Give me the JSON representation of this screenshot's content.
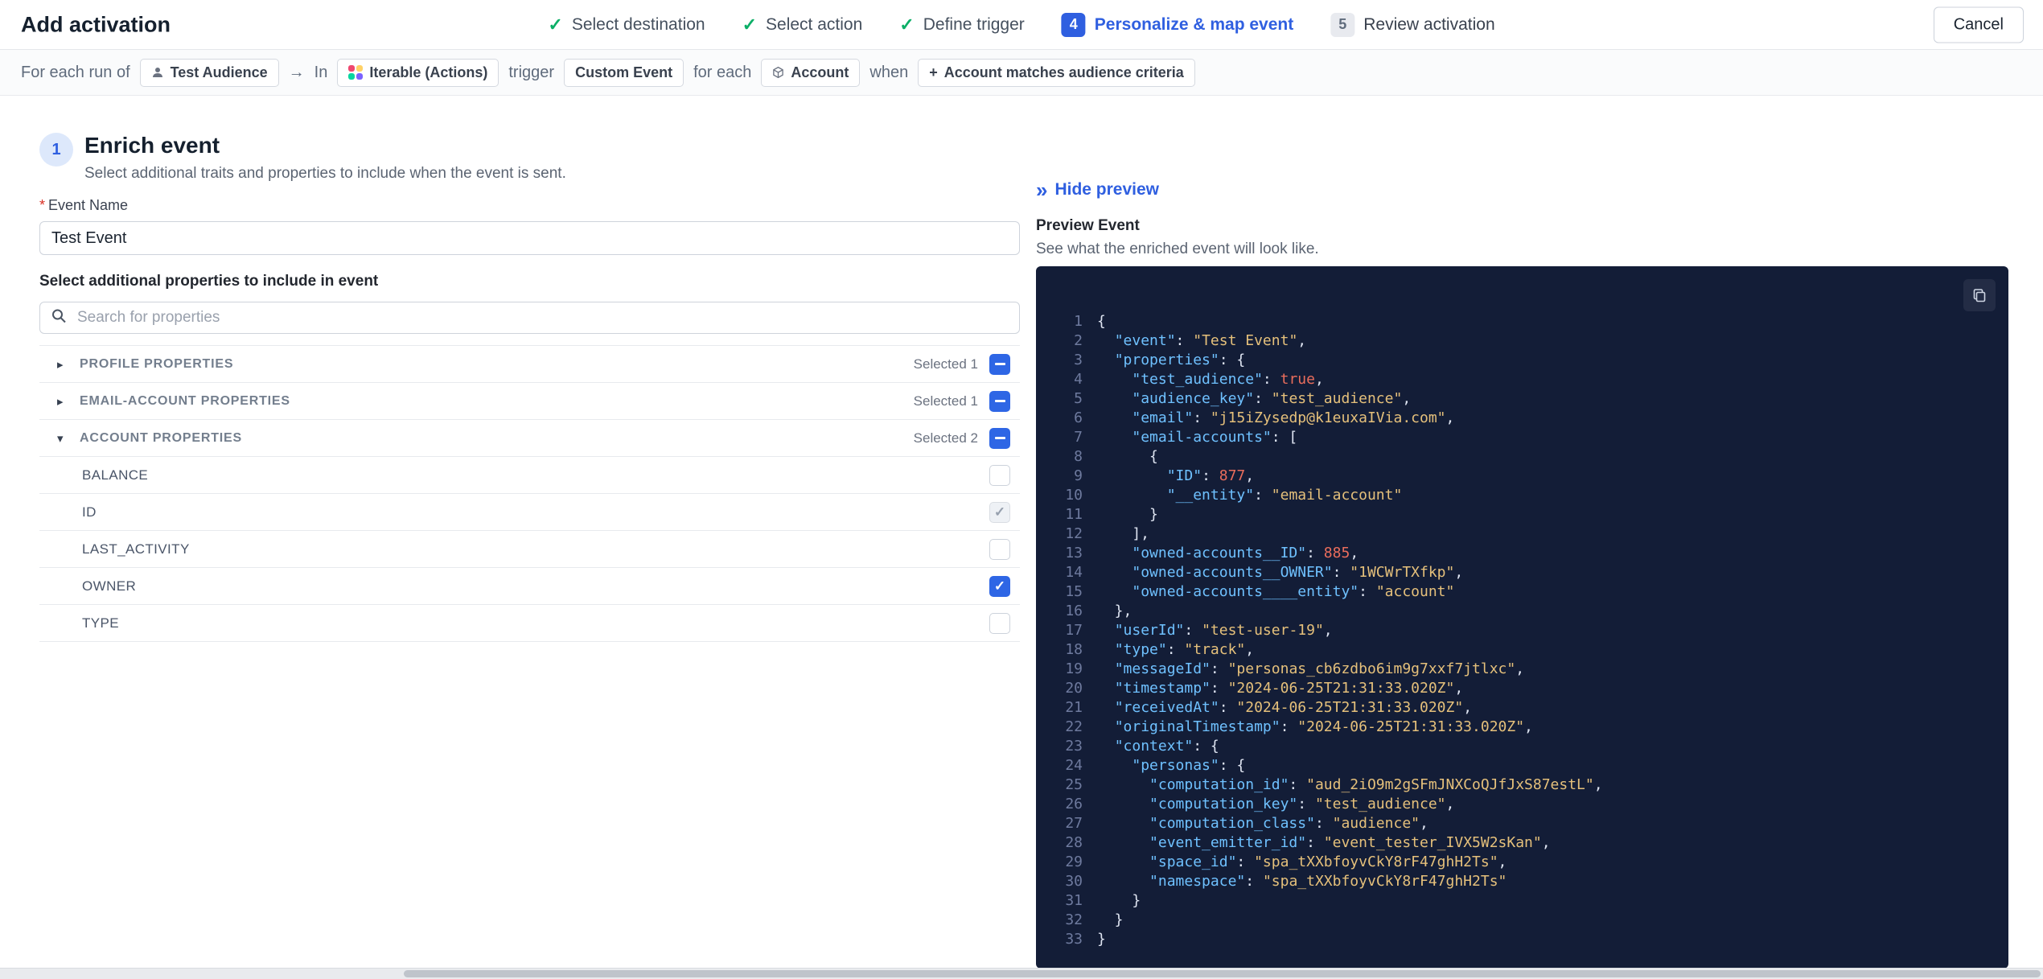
{
  "colors": {
    "accent_blue": "#2f5fe0",
    "checkbox_blue": "#2e66e5",
    "success_green": "#0caf67",
    "code_background": "#131d37",
    "code_key": "#6fc1ff",
    "code_string": "#e5c07b",
    "code_number": "#ea6d5c"
  },
  "icons": {
    "check": "✓",
    "chevron_right": "▸",
    "chevron_down": "▾",
    "arrow": "→",
    "plus": "+",
    "double_chevron": "»"
  },
  "header": {
    "title": "Add activation",
    "cancel_label": "Cancel",
    "steps": [
      {
        "label": "Select destination",
        "state": "complete"
      },
      {
        "label": "Select action",
        "state": "complete"
      },
      {
        "label": "Define trigger",
        "state": "complete"
      },
      {
        "label": "Personalize & map event",
        "state": "active",
        "number": "4"
      },
      {
        "label": "Review activation",
        "state": "upcoming",
        "number": "5"
      }
    ]
  },
  "trigger_bar": {
    "prefix": "For each run of",
    "audience_chip": "Test Audience",
    "in_label": "In",
    "destination_chip": "Iterable (Actions)",
    "trigger_label": "trigger",
    "event_chip": "Custom Event",
    "for_each_label": "for each",
    "entity_chip": "Account",
    "when_label": "when",
    "condition_chip": "Account matches audience criteria"
  },
  "enrich": {
    "step_number": "1",
    "title": "Enrich event",
    "subtitle": "Select additional traits and properties to include when the event is sent.",
    "event_name_label": "Event Name",
    "required_marker": "*",
    "event_name_value": "Test Event",
    "properties_label": "Select additional properties to include in event",
    "search_placeholder": "Search for properties",
    "groups": [
      {
        "label": "PROFILE PROPERTIES",
        "selected": "Selected 1",
        "expanded": false
      },
      {
        "label": "EMAIL-ACCOUNT PROPERTIES",
        "selected": "Selected 1",
        "expanded": false
      },
      {
        "label": "ACCOUNT PROPERTIES",
        "selected": "Selected 2",
        "expanded": true
      }
    ],
    "account_properties": [
      {
        "label": "BALANCE",
        "state": "unchecked"
      },
      {
        "label": "ID",
        "state": "checked-disabled"
      },
      {
        "label": "LAST_ACTIVITY",
        "state": "unchecked"
      },
      {
        "label": "OWNER",
        "state": "checked"
      },
      {
        "label": "TYPE",
        "state": "unchecked"
      }
    ]
  },
  "preview": {
    "hide_label": "Hide preview",
    "title": "Preview Event",
    "subtitle": "See what the enriched event will look like.",
    "code_lines": [
      [
        [
          "p",
          "{"
        ]
      ],
      [
        [
          "p",
          "  "
        ],
        [
          "k",
          "\"event\""
        ],
        [
          "p",
          ": "
        ],
        [
          "s",
          "\"Test Event\""
        ],
        [
          "p",
          ","
        ]
      ],
      [
        [
          "p",
          "  "
        ],
        [
          "k",
          "\"properties\""
        ],
        [
          "p",
          ": {"
        ]
      ],
      [
        [
          "p",
          "    "
        ],
        [
          "k",
          "\"test_audience\""
        ],
        [
          "p",
          ": "
        ],
        [
          "b",
          "true"
        ],
        [
          "p",
          ","
        ]
      ],
      [
        [
          "p",
          "    "
        ],
        [
          "k",
          "\"audience_key\""
        ],
        [
          "p",
          ": "
        ],
        [
          "s",
          "\"test_audience\""
        ],
        [
          "p",
          ","
        ]
      ],
      [
        [
          "p",
          "    "
        ],
        [
          "k",
          "\"email\""
        ],
        [
          "p",
          ": "
        ],
        [
          "s",
          "\"j15iZysedp@k1euxaIVia.com\""
        ],
        [
          "p",
          ","
        ]
      ],
      [
        [
          "p",
          "    "
        ],
        [
          "k",
          "\"email-accounts\""
        ],
        [
          "p",
          ": ["
        ]
      ],
      [
        [
          "p",
          "      {"
        ]
      ],
      [
        [
          "p",
          "        "
        ],
        [
          "k",
          "\"ID\""
        ],
        [
          "p",
          ": "
        ],
        [
          "n",
          "877"
        ],
        [
          "p",
          ","
        ]
      ],
      [
        [
          "p",
          "        "
        ],
        [
          "k",
          "\"__entity\""
        ],
        [
          "p",
          ": "
        ],
        [
          "s",
          "\"email-account\""
        ]
      ],
      [
        [
          "p",
          "      }"
        ]
      ],
      [
        [
          "p",
          "    ],"
        ]
      ],
      [
        [
          "p",
          "    "
        ],
        [
          "k",
          "\"owned-accounts__ID\""
        ],
        [
          "p",
          ": "
        ],
        [
          "n",
          "885"
        ],
        [
          "p",
          ","
        ]
      ],
      [
        [
          "p",
          "    "
        ],
        [
          "k",
          "\"owned-accounts__OWNER\""
        ],
        [
          "p",
          ": "
        ],
        [
          "s",
          "\"1WCWrTXfkp\""
        ],
        [
          "p",
          ","
        ]
      ],
      [
        [
          "p",
          "    "
        ],
        [
          "k",
          "\"owned-accounts____entity\""
        ],
        [
          "p",
          ": "
        ],
        [
          "s",
          "\"account\""
        ]
      ],
      [
        [
          "p",
          "  },"
        ]
      ],
      [
        [
          "p",
          "  "
        ],
        [
          "k",
          "\"userId\""
        ],
        [
          "p",
          ": "
        ],
        [
          "s",
          "\"test-user-19\""
        ],
        [
          "p",
          ","
        ]
      ],
      [
        [
          "p",
          "  "
        ],
        [
          "k",
          "\"type\""
        ],
        [
          "p",
          ": "
        ],
        [
          "s",
          "\"track\""
        ],
        [
          "p",
          ","
        ]
      ],
      [
        [
          "p",
          "  "
        ],
        [
          "k",
          "\"messageId\""
        ],
        [
          "p",
          ": "
        ],
        [
          "s",
          "\"personas_cb6zdbo6im9g7xxf7jtlxc\""
        ],
        [
          "p",
          ","
        ]
      ],
      [
        [
          "p",
          "  "
        ],
        [
          "k",
          "\"timestamp\""
        ],
        [
          "p",
          ": "
        ],
        [
          "s",
          "\"2024-06-25T21:31:33.020Z\""
        ],
        [
          "p",
          ","
        ]
      ],
      [
        [
          "p",
          "  "
        ],
        [
          "k",
          "\"receivedAt\""
        ],
        [
          "p",
          ": "
        ],
        [
          "s",
          "\"2024-06-25T21:31:33.020Z\""
        ],
        [
          "p",
          ","
        ]
      ],
      [
        [
          "p",
          "  "
        ],
        [
          "k",
          "\"originalTimestamp\""
        ],
        [
          "p",
          ": "
        ],
        [
          "s",
          "\"2024-06-25T21:31:33.020Z\""
        ],
        [
          "p",
          ","
        ]
      ],
      [
        [
          "p",
          "  "
        ],
        [
          "k",
          "\"context\""
        ],
        [
          "p",
          ": {"
        ]
      ],
      [
        [
          "p",
          "    "
        ],
        [
          "k",
          "\"personas\""
        ],
        [
          "p",
          ": {"
        ]
      ],
      [
        [
          "p",
          "      "
        ],
        [
          "k",
          "\"computation_id\""
        ],
        [
          "p",
          ": "
        ],
        [
          "s",
          "\"aud_2iO9m2gSFmJNXCoQJfJxS87estL\""
        ],
        [
          "p",
          ","
        ]
      ],
      [
        [
          "p",
          "      "
        ],
        [
          "k",
          "\"computation_key\""
        ],
        [
          "p",
          ": "
        ],
        [
          "s",
          "\"test_audience\""
        ],
        [
          "p",
          ","
        ]
      ],
      [
        [
          "p",
          "      "
        ],
        [
          "k",
          "\"computation_class\""
        ],
        [
          "p",
          ": "
        ],
        [
          "s",
          "\"audience\""
        ],
        [
          "p",
          ","
        ]
      ],
      [
        [
          "p",
          "      "
        ],
        [
          "k",
          "\"event_emitter_id\""
        ],
        [
          "p",
          ": "
        ],
        [
          "s",
          "\"event_tester_IVX5W2sKan\""
        ],
        [
          "p",
          ","
        ]
      ],
      [
        [
          "p",
          "      "
        ],
        [
          "k",
          "\"space_id\""
        ],
        [
          "p",
          ": "
        ],
        [
          "s",
          "\"spa_tXXbfoyvCkY8rF47ghH2Ts\""
        ],
        [
          "p",
          ","
        ]
      ],
      [
        [
          "p",
          "      "
        ],
        [
          "k",
          "\"namespace\""
        ],
        [
          "p",
          ": "
        ],
        [
          "s",
          "\"spa_tXXbfoyvCkY8rF47ghH2Ts\""
        ]
      ],
      [
        [
          "p",
          "    }"
        ]
      ],
      [
        [
          "p",
          "  }"
        ]
      ],
      [
        [
          "p",
          "}"
        ]
      ]
    ]
  }
}
